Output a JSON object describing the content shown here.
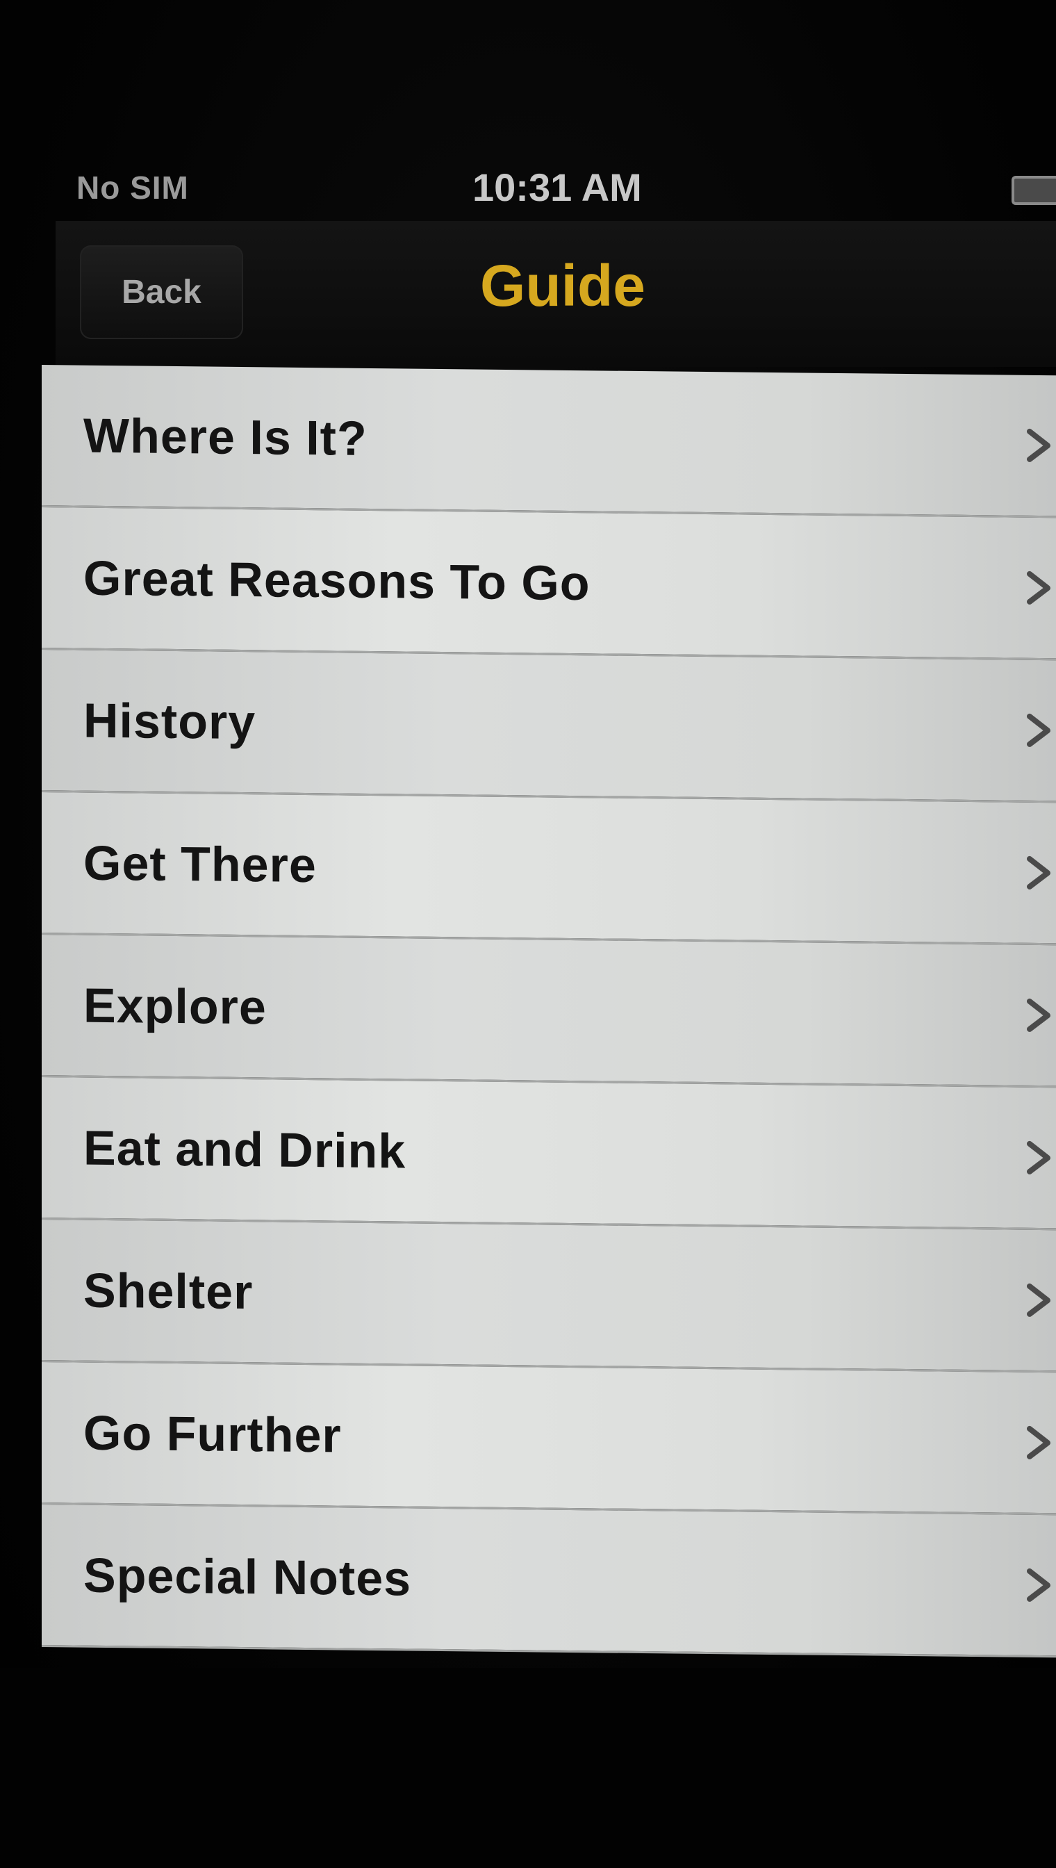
{
  "status_bar": {
    "carrier": "No SIM",
    "time": "10:31 AM"
  },
  "nav_bar": {
    "back_label": "Back",
    "title": "Guide"
  },
  "menu": {
    "items": [
      {
        "label": "Where Is It?"
      },
      {
        "label": "Great Reasons To Go"
      },
      {
        "label": "History"
      },
      {
        "label": "Get There"
      },
      {
        "label": "Explore"
      },
      {
        "label": "Eat and Drink"
      },
      {
        "label": "Shelter"
      },
      {
        "label": "Go Further"
      },
      {
        "label": "Special Notes"
      }
    ]
  },
  "icons": {
    "row_accessory": "chevron-right-icon",
    "battery": "battery-icon"
  },
  "colors": {
    "title": "#d6a81f",
    "nav_background": "#0a0a0a",
    "row_text": "#141414"
  }
}
